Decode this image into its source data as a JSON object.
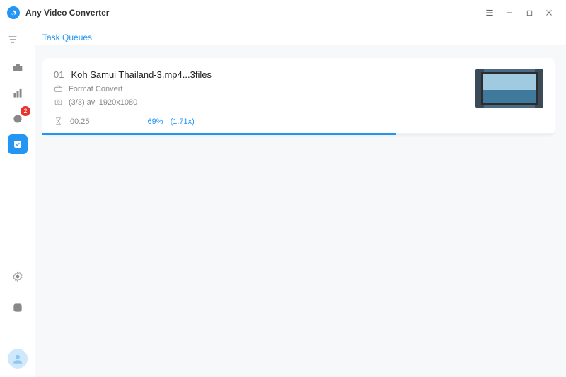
{
  "app": {
    "title": "Any Video Converter"
  },
  "sidebar": {
    "filter_label": "filter",
    "items": [
      {
        "name": "toolbox"
      },
      {
        "name": "stats"
      },
      {
        "name": "downloads",
        "badge": "2"
      },
      {
        "name": "tasks",
        "active": true
      }
    ]
  },
  "tabs": {
    "task_queues": "Task Queues"
  },
  "task": {
    "index": "01",
    "filename": "Koh Samui Thailand-3.mp4...3files",
    "operation": "Format Convert",
    "details": "(3/3) avi 1920x1080",
    "elapsed": "00:25",
    "percent": "69%",
    "speed": "(1.71x)",
    "progress_pct": 69
  }
}
